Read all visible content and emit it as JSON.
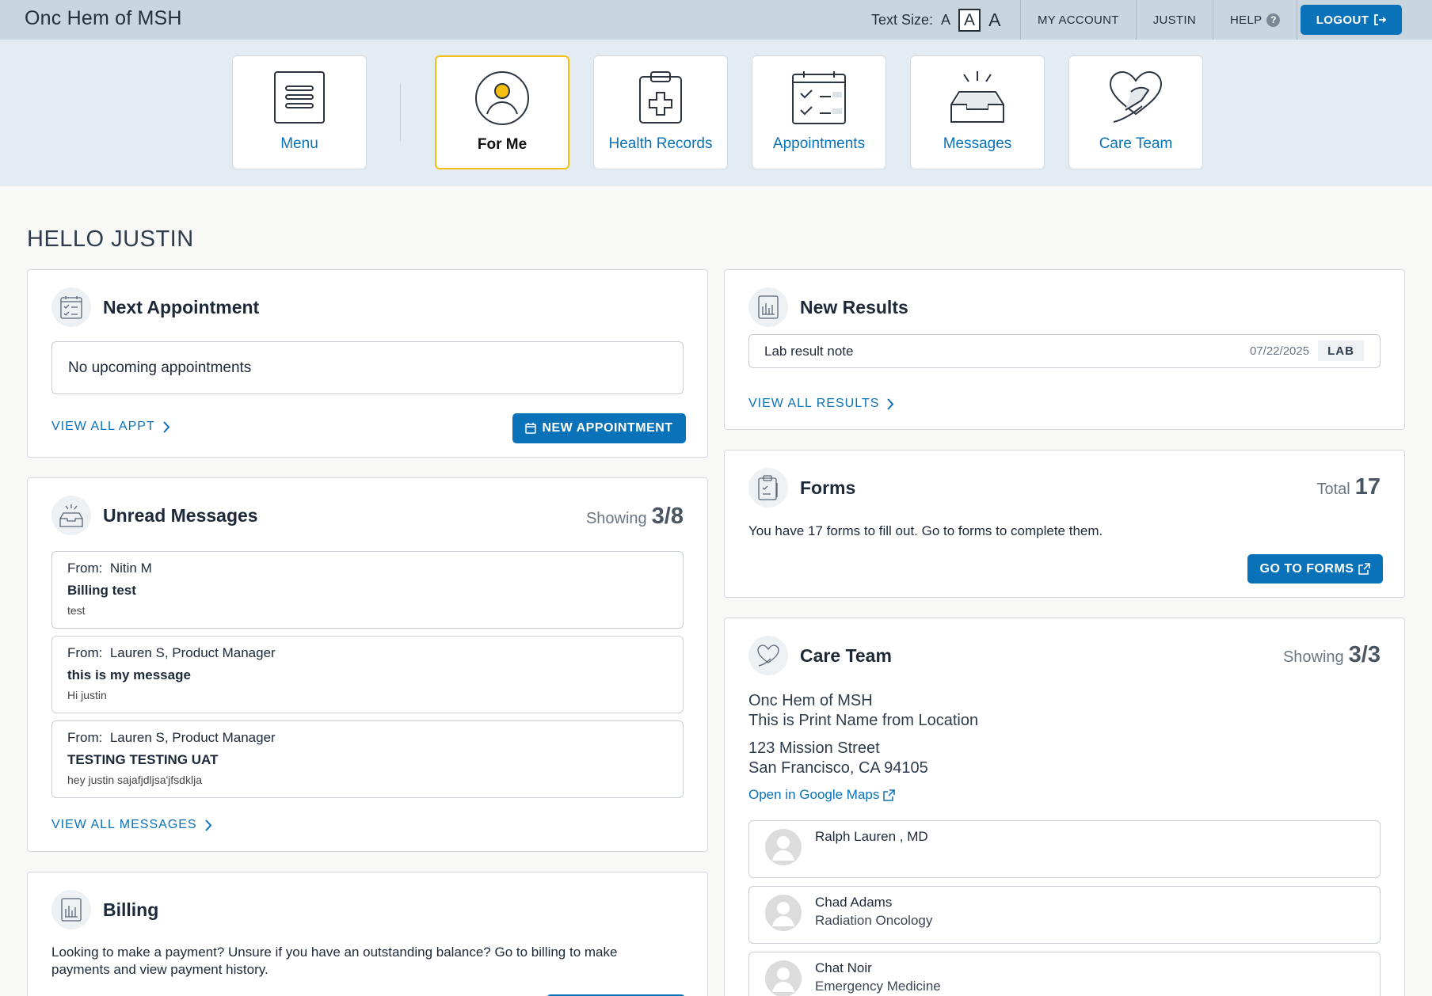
{
  "header": {
    "org_name": "Onc Hem of MSH",
    "text_size_label": "Text Size:",
    "text_size_options": [
      "A",
      "A",
      "A"
    ],
    "links": {
      "account": "MY ACCOUNT",
      "user": "JUSTIN",
      "help": "HELP"
    },
    "help_icon": "?",
    "logout": "LOGOUT"
  },
  "nav": [
    {
      "label": "Menu",
      "icon": "menu-icon"
    },
    {
      "label": "For Me",
      "icon": "person-icon",
      "active": true
    },
    {
      "label": "Health Records",
      "icon": "clipboard-plus-icon"
    },
    {
      "label": "Appointments",
      "icon": "calendar-checklist-icon"
    },
    {
      "label": "Messages",
      "icon": "inbox-icon"
    },
    {
      "label": "Care Team",
      "icon": "heart-hand-icon"
    }
  ],
  "greeting": "HELLO JUSTIN",
  "next_appointment": {
    "title": "Next Appointment",
    "empty_text": "No upcoming appointments",
    "view_all": "VIEW ALL APPT",
    "new_button": "NEW APPOINTMENT"
  },
  "unread_messages": {
    "title": "Unread Messages",
    "showing_label": "Showing",
    "showing_count": "3/8",
    "from_label": "From:",
    "items": [
      {
        "from": "Nitin M",
        "subject": "Billing test",
        "preview": "test"
      },
      {
        "from": "Lauren S, Product Manager",
        "subject": "this is my message",
        "preview": "Hi justin"
      },
      {
        "from": "Lauren S, Product Manager",
        "subject": "TESTING TESTING UAT",
        "preview": "hey justin sajafjdljsa'jfsdklja"
      }
    ],
    "view_all": "VIEW ALL MESSAGES"
  },
  "billing": {
    "title": "Billing",
    "text": "Looking to make a payment? Unsure if you have an outstanding balance? Go to billing to make payments and view payment history."
  },
  "new_results": {
    "title": "New Results",
    "items": [
      {
        "name": "Lab result note",
        "date": "07/22/2025",
        "type": "LAB"
      }
    ],
    "view_all": "VIEW ALL RESULTS"
  },
  "forms": {
    "title": "Forms",
    "total_label": "Total",
    "total": "17",
    "text": "You have 17 forms to fill out. Go to forms to complete them.",
    "button": "GO TO FORMS"
  },
  "care_team": {
    "title": "Care Team",
    "showing_label": "Showing",
    "showing_count": "3/3",
    "location_name": "Onc Hem of MSH",
    "print_name": "This is Print Name from Location",
    "address_line1": "123 Mission Street",
    "address_line2": "San Francisco, CA 94105",
    "maps_link": "Open in Google Maps",
    "members": [
      {
        "name": "Ralph Lauren , MD",
        "specialty": ""
      },
      {
        "name": "Chad Adams",
        "specialty": "Radiation Oncology"
      },
      {
        "name": "Chat Noir",
        "specialty": "Emergency Medicine"
      }
    ]
  },
  "colors": {
    "accent": "#0a72b8",
    "active_border": "#f5bf10",
    "topbar": "#c9d6df",
    "nav_band": "#e4ecf3"
  }
}
